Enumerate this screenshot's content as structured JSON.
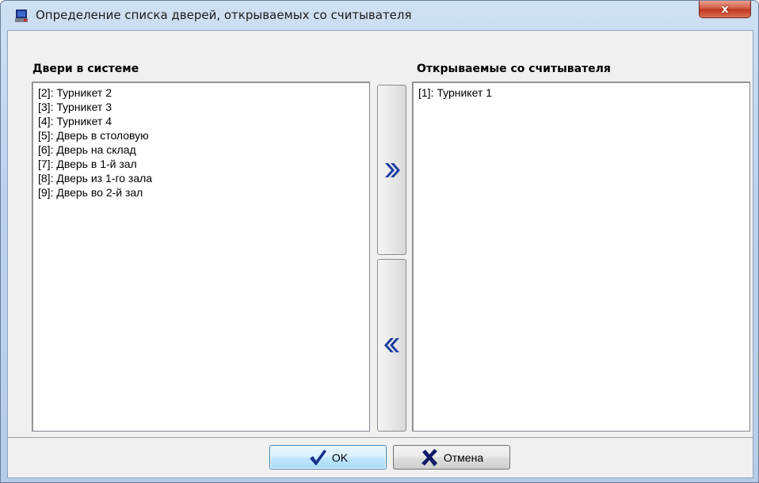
{
  "window": {
    "title": "Определение списка дверей, открываемых со считывателя",
    "close_label": "x"
  },
  "left_panel": {
    "label": "Двери в системе",
    "items": [
      "[2]: Турникет 2",
      "[3]: Турникет 3",
      "[4]: Турникет 4",
      "[5]: Дверь в столовую",
      "[6]: Дверь на склад",
      "[7]: Дверь в 1-й зал",
      "[8]: Дверь из 1-го зала",
      "[9]: Дверь во 2-й зал"
    ]
  },
  "right_panel": {
    "label": "Открываемые со считывателя",
    "items": [
      "[1]: Турникет 1"
    ]
  },
  "move_buttons": {
    "add_icon": "double-chevron-right-icon",
    "remove_icon": "double-chevron-left-icon"
  },
  "buttons": {
    "ok_label": "OK",
    "cancel_label": "Отмена",
    "ok_icon": "checkmark-icon",
    "cancel_icon": "cross-icon"
  },
  "colors": {
    "chevron": "#1c3fa0",
    "check": "#1a2f8a",
    "cross": "#0f1a66"
  }
}
